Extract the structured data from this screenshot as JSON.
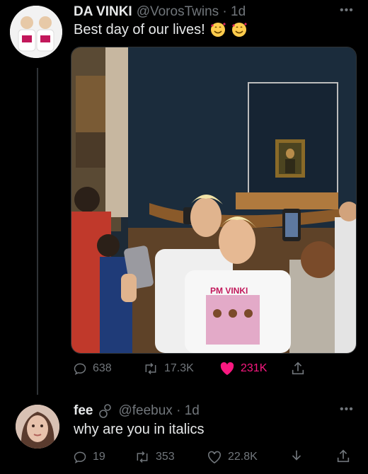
{
  "post": {
    "author_name": "DA VINKI",
    "handle_time": "@VorosTwins · 1d",
    "text": "Best day of our lives!",
    "media_alt_art": "PM VINKI",
    "actions": {
      "replies": "638",
      "retweets": "17.3K",
      "likes": "231K"
    }
  },
  "reply": {
    "author_name": "fee",
    "handle_time": "@feebux · 1d",
    "text": "why are you in italics",
    "actions": {
      "replies": "19",
      "retweets": "353",
      "likes": "22.8K"
    }
  },
  "colors": {
    "background": "#000000",
    "text": "#e7e9ea",
    "secondary": "#71767b",
    "like": "#f91880"
  },
  "icons": [
    "reply-icon",
    "retweet-icon",
    "heart-icon",
    "share-icon",
    "download-icon",
    "more-icon",
    "smiling-face-with-hearts-emoji",
    "link-icon"
  ]
}
